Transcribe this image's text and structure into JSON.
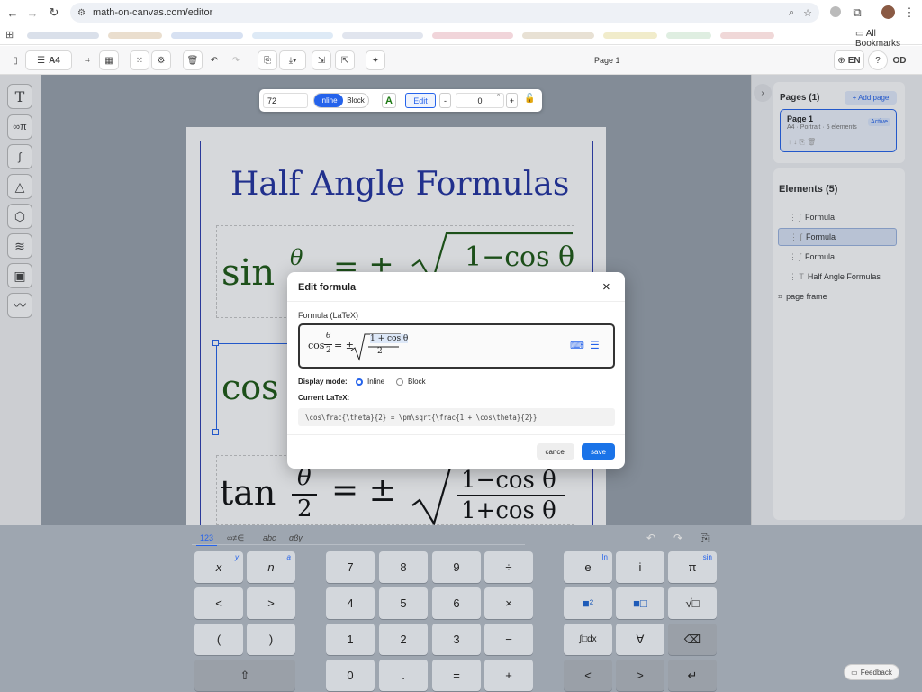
{
  "browser": {
    "url": "math-on-canvas.com/editor",
    "bookmarks_label": "All Bookmarks"
  },
  "toolbar": {
    "page_size": "A4",
    "page_label": "Page 1",
    "language": "EN",
    "user_initials": "OD"
  },
  "canvas": {
    "title": "Half Angle Formulas",
    "formula1_lhs": "sin",
    "formula1_num": "θ",
    "formula1_eq": "= ±",
    "formula1_rad": "1−cos θ",
    "formula2_lhs": "cos",
    "formula3_lhs": "tan",
    "formula3_num": "θ",
    "formula3_den": "2",
    "formula3_eq": "= ±",
    "formula3_rad_num": "1−cos θ",
    "formula3_rad_den": "1+cos θ"
  },
  "formula_toolbar": {
    "size": "72",
    "inline_label": "Inline",
    "block_label": "Block",
    "color_label": "A",
    "edit_label": "Edit",
    "minus_label": "-",
    "rotation": "0",
    "degree": "°",
    "plus_label": "+"
  },
  "modal": {
    "title": "Edit formula",
    "close": "×",
    "field_label": "Formula (LaTeX)",
    "preview_lhs": "cos",
    "preview_num": "θ",
    "preview_den": "2",
    "preview_eq": "= ±",
    "preview_rad_num": "1 + cos θ",
    "preview_rad_den": "2",
    "display_mode_label": "Display mode:",
    "option_inline": "Inline",
    "option_block": "Block",
    "current_latex_label": "Current LaTeX:",
    "latex": "\\cos\\frac{\\theta}{2} = \\pm\\sqrt{\\frac{1 + \\cos\\theta}{2}}",
    "cancel": "cancel",
    "save": "save"
  },
  "pages_panel": {
    "header": "Pages (1)",
    "add_page": "+ Add page",
    "page_name": "Page 1",
    "page_meta": "A4 · Portrait · 5 elements",
    "active_badge": "Active"
  },
  "elements_panel": {
    "header": "Elements (5)",
    "items": [
      {
        "label": "Formula",
        "icon": "formula-icon"
      },
      {
        "label": "Formula",
        "icon": "formula-icon"
      },
      {
        "label": "Formula",
        "icon": "formula-icon"
      },
      {
        "label": "Half Angle Formulas",
        "icon": "text-icon"
      },
      {
        "label": "page frame",
        "icon": "frame-icon"
      }
    ]
  },
  "keyboard": {
    "tabs": [
      "123",
      "∞≠∈",
      "abc",
      "αβγ"
    ],
    "rows": [
      [
        "x",
        "n",
        "7",
        "8",
        "9",
        "÷",
        "e",
        "i",
        "π"
      ],
      [
        "<",
        ">",
        "4",
        "5",
        "6",
        "×",
        "■²",
        "■□",
        "√□"
      ],
      [
        "(",
        ")",
        "1",
        "2",
        "3",
        "−",
        "∫□dx",
        "∀",
        "⌫"
      ],
      [
        "⇧",
        "0",
        ".",
        "=",
        "+",
        "<",
        ">",
        "↵"
      ]
    ],
    "sub_labels": {
      "x": "y",
      "n": "a",
      "e": "ln",
      "pi": "sin"
    }
  },
  "feedback": "Feedback",
  "colors": {
    "accent": "#2563eb",
    "frame": "#2f3fb0",
    "title_blue": "#2333a0",
    "formula_green": "#1e5a14"
  }
}
